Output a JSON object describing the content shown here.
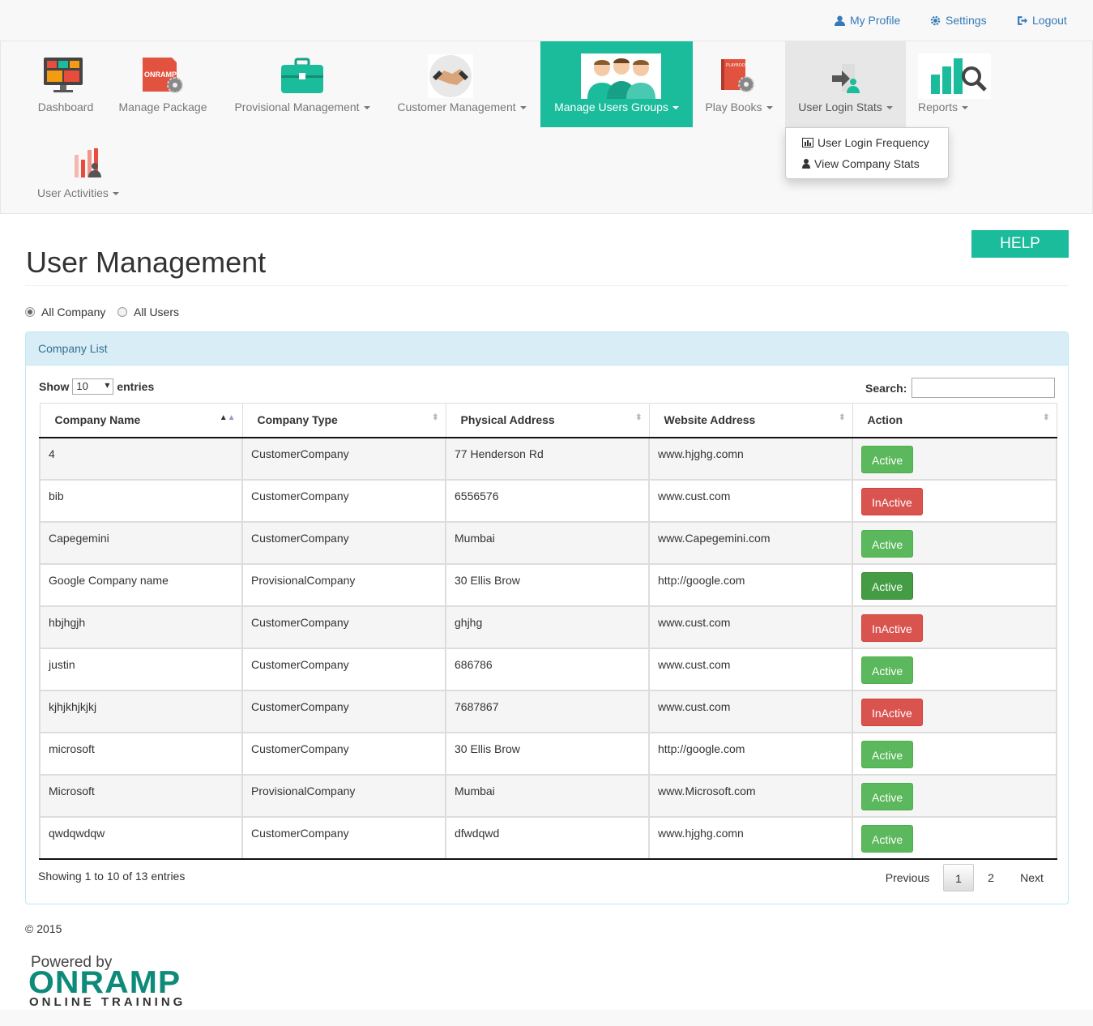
{
  "top_links": {
    "profile": "My Profile",
    "settings": "Settings",
    "logout": "Logout"
  },
  "nav": {
    "dashboard": "Dashboard",
    "manage_package": "Manage Package",
    "provisional_management": "Provisional Management",
    "customer_management": "Customer Management",
    "manage_users_groups": "Manage Users Groups",
    "play_books": "Play Books",
    "user_login_stats": "User Login Stats",
    "reports": "Reports",
    "user_activities": "User Activities",
    "onramp_icon_text": "ONRAMP",
    "playbook_icon_text": "PLAYBOOK"
  },
  "dropdown": {
    "item1": "User Login Frequency",
    "item2": "View Company Stats"
  },
  "page": {
    "title": "User Management",
    "help": "HELP"
  },
  "filter": {
    "all_company": "All Company",
    "all_users": "All Users",
    "selected": "All Company"
  },
  "panel": {
    "heading": "Company List"
  },
  "table_controls": {
    "show": "Show",
    "length": "10",
    "entries": "entries",
    "search_label": "Search:",
    "search_value": ""
  },
  "table": {
    "headers": [
      "Company Name",
      "Company Type",
      "Physical Address",
      "Website Address",
      "Action"
    ],
    "rows": [
      [
        "4",
        "CustomerCompany",
        "77 Henderson Rd",
        "www.hjghg.comn",
        "Active"
      ],
      [
        "bib",
        "CustomerCompany",
        "6556576",
        "www.cust.com",
        "InActive"
      ],
      [
        "Capegemini",
        "CustomerCompany",
        "Mumbai",
        "www.Capegemini.com",
        "Active"
      ],
      [
        "Google Company name",
        "ProvisionalCompany",
        "30 Ellis Brow",
        "http://google.com",
        "Active"
      ],
      [
        "hbjhgjh",
        "CustomerCompany",
        "ghjhg",
        "www.cust.com",
        "InActive"
      ],
      [
        "justin",
        "CustomerCompany",
        "686786",
        "www.cust.com",
        "Active"
      ],
      [
        "kjhjkhjkjkj",
        "CustomerCompany",
        "7687867",
        "www.cust.com",
        "InActive"
      ],
      [
        "microsoft",
        "CustomerCompany",
        "30 Ellis Brow",
        "http://google.com",
        "Active"
      ],
      [
        "Microsoft",
        "ProvisionalCompany",
        "Mumbai",
        "www.Microsoft.com",
        "Active"
      ],
      [
        "qwdqwdqw",
        "CustomerCompany",
        "dfwdqwd",
        "www.hjghg.comn",
        "Active"
      ]
    ]
  },
  "pagination": {
    "info": "Showing 1 to 10 of 13 entries",
    "previous": "Previous",
    "page1": "1",
    "page2": "2",
    "next": "Next"
  },
  "footer": {
    "copyright": "© 2015",
    "powered_by": "Powered by",
    "brand": "ONRAMP",
    "tagline": "ONLINE TRAINING"
  },
  "colors": {
    "accent": "#1abc9c",
    "active_green": "#5cb85c",
    "inactive_red": "#d9534f",
    "link_blue": "#337ab7",
    "panel_head": "#d9edf7"
  }
}
